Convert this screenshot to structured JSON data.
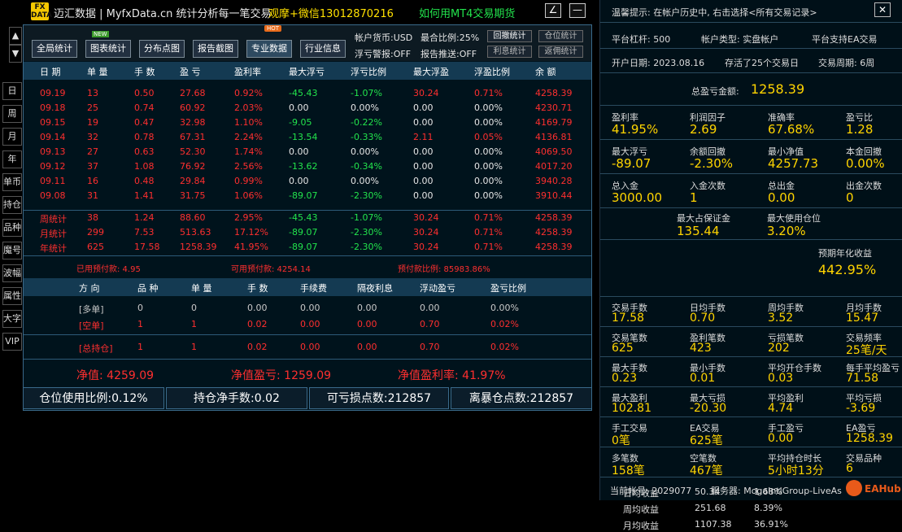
{
  "app": {
    "logo_text": "FX DATA",
    "title": "迈汇数据 | MyfxData.cn  统计分析每一笔交易",
    "promo1": "观摩+微信13012870216",
    "promo2": "如何用MT4交易期货",
    "min_label": "∠",
    "close_label": "—"
  },
  "sidebar": {
    "up": "▲",
    "down": "▼",
    "items": [
      "日",
      "周",
      "月",
      "年",
      "单币",
      "持仓",
      "品种",
      "魔号",
      "波幅",
      "属性",
      "大字",
      "VIP"
    ]
  },
  "toolbar": {
    "buttons": [
      "全局统计",
      "图表统计",
      "分布点图",
      "报告截图",
      "专业数据",
      "行业信息"
    ],
    "new_badge": "NEW",
    "hot_badge": "HOT",
    "info": {
      "currency": "帐户货币:USD",
      "exposure": "最合比例:25%",
      "float_warn": "浮亏警报:OFF",
      "report_push": "报告推送:OFF"
    },
    "small_buttons": [
      "回撤统计",
      "仓位统计",
      "利息统计",
      "返佣统计"
    ]
  },
  "table": {
    "headers": [
      "日 期",
      "单 量",
      "手 数",
      "盈 亏",
      "盈利率",
      "最大浮亏",
      "浮亏比例",
      "最大浮盈",
      "浮盈比例",
      "余 额"
    ],
    "rows": [
      [
        "09.19",
        "13",
        "0.50",
        "27.68",
        "0.92%",
        "-45.43",
        "-1.07%",
        "30.24",
        "0.71%",
        "4258.39"
      ],
      [
        "09.18",
        "25",
        "0.74",
        "60.92",
        "2.03%",
        "0.00",
        "0.00%",
        "0.00",
        "0.00%",
        "4230.71"
      ],
      [
        "09.15",
        "19",
        "0.47",
        "32.98",
        "1.10%",
        "-9.05",
        "-0.22%",
        "0.00",
        "0.00%",
        "4169.79"
      ],
      [
        "09.14",
        "32",
        "0.78",
        "67.31",
        "2.24%",
        "-13.54",
        "-0.33%",
        "2.11",
        "0.05%",
        "4136.81"
      ],
      [
        "09.13",
        "27",
        "0.63",
        "52.30",
        "1.74%",
        "0.00",
        "0.00%",
        "0.00",
        "0.00%",
        "4069.50"
      ],
      [
        "09.12",
        "37",
        "1.08",
        "76.92",
        "2.56%",
        "-13.62",
        "-0.34%",
        "0.00",
        "0.00%",
        "4017.20"
      ],
      [
        "09.11",
        "16",
        "0.48",
        "29.84",
        "0.99%",
        "0.00",
        "0.00%",
        "0.00",
        "0.00%",
        "3940.28"
      ],
      [
        "09.08",
        "31",
        "1.41",
        "31.75",
        "1.06%",
        "-89.07",
        "-2.30%",
        "0.00",
        "0.00%",
        "3910.44"
      ]
    ],
    "summary": [
      [
        "周统计",
        "38",
        "1.24",
        "88.60",
        "2.95%",
        "-45.43",
        "-1.07%",
        "30.24",
        "0.71%",
        "4258.39"
      ],
      [
        "月统计",
        "299",
        "7.53",
        "513.63",
        "17.12%",
        "-89.07",
        "-2.30%",
        "30.24",
        "0.71%",
        "4258.39"
      ],
      [
        "年统计",
        "625",
        "17.58",
        "1258.39",
        "41.95%",
        "-89.07",
        "-2.30%",
        "30.24",
        "0.71%",
        "4258.39"
      ]
    ],
    "prepay": {
      "used": "已用预付款: 4.95",
      "available": "可用预付款: 4254.14",
      "ratio": "预付款比例: 85983.86%"
    }
  },
  "positions": {
    "headers": [
      "方 向",
      "品 种",
      "单 量",
      "手 数",
      "手续费",
      "隔夜利息",
      "浮动盈亏",
      "盈亏比例"
    ],
    "rows": [
      [
        "[多单]",
        "0",
        "0",
        "0.00",
        "0.00",
        "0.00",
        "0.00",
        "0.00%"
      ],
      [
        "[空单]",
        "1",
        "1",
        "0.02",
        "0.00",
        "0.00",
        "0.70",
        "0.02%"
      ],
      [
        "[总持仓]",
        "1",
        "1",
        "0.02",
        "0.00",
        "0.00",
        "0.70",
        "0.02%"
      ]
    ]
  },
  "totals": {
    "equity": "净值: 4259.09",
    "net_profit": "净值盈亏: 1259.09",
    "net_rate": "净值盈利率: 41.97%"
  },
  "bottom_bar": [
    "仓位使用比例:0.12%",
    "持仓净手数:0.02",
    "可亏损点数:212857",
    "离暴仓点数:212857"
  ],
  "right": {
    "tip": "温馨提示: 在帐户历史中, 右击选择<所有交易记录>",
    "close": "✕",
    "platform_leverage": "平台杠杆: 500",
    "account_type": "帐户类型: 实盘帐户",
    "ea_support": "平台支持EA交易",
    "open_date": "开户日期: 2023.08.16",
    "alive": "存活了25个交易日",
    "cycle": "交易周期: 6周",
    "total_pl_label": "总盈亏金额:",
    "total_pl_value": "1258.39",
    "grid1": [
      {
        "l": "盈利率",
        "v": "41.95%"
      },
      {
        "l": "利润因子",
        "v": "2.69"
      },
      {
        "l": "准确率",
        "v": "67.68%"
      },
      {
        "l": "盈亏比",
        "v": "1.28"
      },
      {
        "l": "最大浮亏",
        "v": "-89.07"
      },
      {
        "l": "余额回撤",
        "v": "-2.30%"
      },
      {
        "l": "最小净值",
        "v": "4257.73"
      },
      {
        "l": "本金回撤",
        "v": "0.00%"
      },
      {
        "l": "总入金",
        "v": "3000.00"
      },
      {
        "l": "入金次数",
        "v": "1"
      },
      {
        "l": "总出金",
        "v": "0.00"
      },
      {
        "l": "出金次数",
        "v": "0"
      }
    ],
    "margin": [
      {
        "l": "最大占保证金",
        "v": "135.44"
      },
      {
        "l": "最大使用仓位",
        "v": "3.20%"
      }
    ],
    "avg": [
      {
        "l": "日均收益",
        "a": "50.34",
        "b": "1.68%"
      },
      {
        "l": "周均收益",
        "a": "251.68",
        "b": "8.39%"
      },
      {
        "l": "月均收益",
        "a": "1107.38",
        "b": "36.91%"
      }
    ],
    "annual_label": "预期年化收益",
    "annual_value": "442.95%",
    "grid2": [
      {
        "l": "交易手数",
        "v": "17.58"
      },
      {
        "l": "日均手数",
        "v": "0.70"
      },
      {
        "l": "周均手数",
        "v": "3.52"
      },
      {
        "l": "月均手数",
        "v": "15.47"
      },
      {
        "l": "交易笔数",
        "v": "625"
      },
      {
        "l": "盈利笔数",
        "v": "423"
      },
      {
        "l": "亏损笔数",
        "v": "202"
      },
      {
        "l": "交易频率",
        "v": "25笔/天"
      },
      {
        "l": "最大手数",
        "v": "0.23"
      },
      {
        "l": "最小手数",
        "v": "0.01"
      },
      {
        "l": "平均开仓手数",
        "v": "0.03"
      },
      {
        "l": "每手平均盈亏",
        "v": "71.58"
      },
      {
        "l": "最大盈利",
        "v": "102.81"
      },
      {
        "l": "最大亏损",
        "v": "-20.30"
      },
      {
        "l": "平均盈利",
        "v": "4.74"
      },
      {
        "l": "平均亏损",
        "v": "-3.69"
      },
      {
        "l": "手工交易",
        "v": "0笔"
      },
      {
        "l": "EA交易",
        "v": "625笔"
      },
      {
        "l": "手工盈亏",
        "v": "0.00"
      },
      {
        "l": "EA盈亏",
        "v": "1258.39"
      },
      {
        "l": "多笔数",
        "v": "158笔"
      },
      {
        "l": "空笔数",
        "v": "467笔"
      },
      {
        "l": "平均持仓时长",
        "v": "5小时13分"
      },
      {
        "l": "交易品种",
        "v": "6"
      }
    ],
    "account_no": "当前帐号: 2029077",
    "server": "服务器: MogaIntlGroup-LiveAs",
    "ea_brand": "EAHub"
  },
  "colors": {
    "accent": "#ffd400",
    "profit": "#ff2f2f",
    "loss": "#22e34c",
    "header_bg": "#143a52"
  }
}
